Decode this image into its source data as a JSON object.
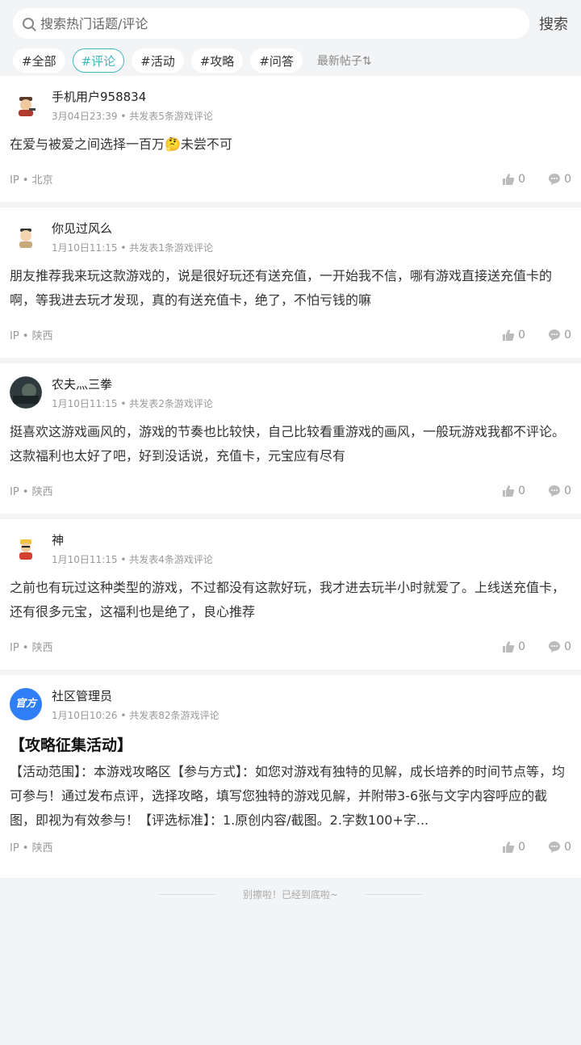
{
  "search": {
    "placeholder": "搜索热门话题/评论",
    "button": "搜索"
  },
  "tags": [
    {
      "label": "#全部"
    },
    {
      "label": "#评论",
      "active": true
    },
    {
      "label": "#活动"
    },
    {
      "label": "#攻略"
    },
    {
      "label": "#问答"
    }
  ],
  "sort_label": "最新帖子⇅",
  "posts": [
    {
      "user": "手机用户958834",
      "time": "3月04日23:39",
      "stats": "• 共发表5条游戏评论",
      "content": "在爱与被爱之间选择一百万🤔未尝不可",
      "ip": "IP • 北京",
      "likes": "0",
      "comments": "0"
    },
    {
      "user": "你见过风么",
      "time": "1月10日11:15",
      "stats": "• 共发表1条游戏评论",
      "content": "朋友推荐我来玩这款游戏的，说是很好玩还有送充值，一开始我不信，哪有游戏直接送充值卡的啊，等我进去玩才发现，真的有送充值卡，绝了，不怕亏钱的嘛",
      "ip": "IP • 陕西",
      "likes": "0",
      "comments": "0"
    },
    {
      "user": "农夫灬三拳",
      "time": "1月10日11:15",
      "stats": "• 共发表2条游戏评论",
      "content": "挺喜欢这游戏画风的，游戏的节奏也比较快，自己比较看重游戏的画风，一般玩游戏我都不评论。这款福利也太好了吧，好到没话说，充值卡，元宝应有尽有",
      "ip": "IP • 陕西",
      "likes": "0",
      "comments": "0"
    },
    {
      "user": "神",
      "time": "1月10日11:15",
      "stats": "• 共发表4条游戏评论",
      "content": "之前也有玩过这种类型的游戏，不过都没有这款好玩，我才进去玩半小时就爱了。上线送充值卡，还有很多元宝，这福利也是绝了，良心推荐",
      "ip": "IP • 陕西",
      "likes": "0",
      "comments": "0"
    },
    {
      "user": "社区管理员",
      "badge": "官方",
      "time": "1月10日10:26",
      "stats": "• 共发表82条游戏评论",
      "title": "【攻略征集活动】",
      "content": "【活动范围】：本游戏攻略区【参与方式】：如您对游戏有独特的见解，成长培养的时间节点等，均可参与！通过发布点评，选择攻略，填写您独特的游戏见解，并附带3-6张与文字内容呼应的截图，即视为有效参与！【评选标准】：1.原创内容/截图。2.字数100+字...",
      "ip": "IP • 陕西",
      "likes": "0",
      "comments": "0"
    }
  ],
  "end_text": "别擦啦！已经到底啦~",
  "colors": {
    "accent": "#3fb6c3",
    "badge_blue": "#2f7ef5",
    "background": "#f3f4f6"
  }
}
